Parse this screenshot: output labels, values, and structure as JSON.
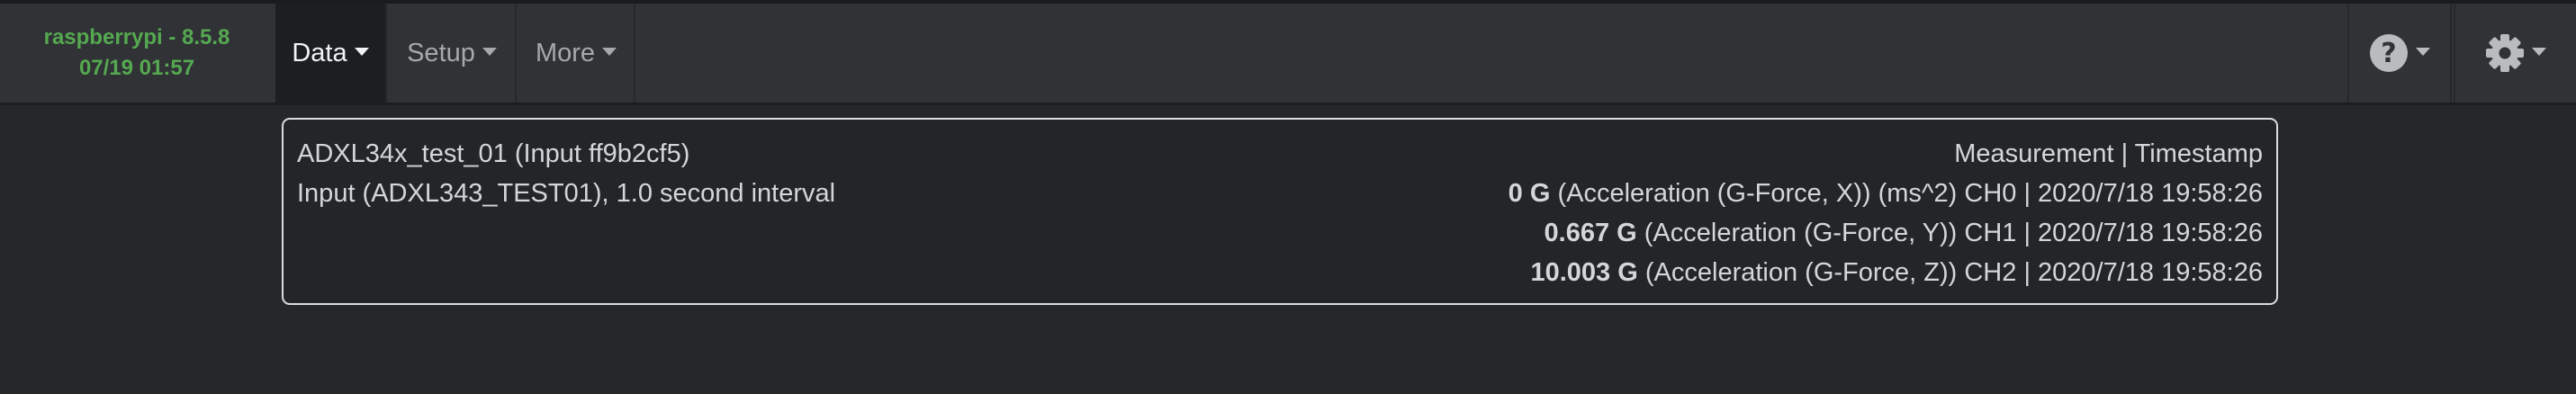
{
  "brand": {
    "host_version": "raspberrypi - 8.5.8",
    "datetime": "07/19 01:57"
  },
  "nav": {
    "data_label": "Data",
    "setup_label": "Setup",
    "more_label": "More"
  },
  "card": {
    "title": "ADXL34x_test_01 (Input ff9b2cf5)",
    "subtitle": "Input (ADXL343_TEST01), 1.0 second interval",
    "header": "Measurement | Timestamp",
    "measurements": [
      {
        "value": "0 G",
        "detail": " (Acceleration (G-Force, X)) (ms^2) CH0 | 2020/7/18 19:58:26"
      },
      {
        "value": "0.667 G",
        "detail": " (Acceleration (G-Force, Y)) CH1 | 2020/7/18 19:58:26"
      },
      {
        "value": "10.003 G",
        "detail": " (Acceleration (G-Force, Z)) CH2 | 2020/7/18 19:58:26"
      }
    ]
  },
  "icons": {
    "help": "question-circle-icon",
    "settings": "gear-icon"
  },
  "colors": {
    "brand_text": "#55a850",
    "navbar_bg": "#303236",
    "page_bg": "#25272b",
    "card_border": "#dcdcdc"
  }
}
